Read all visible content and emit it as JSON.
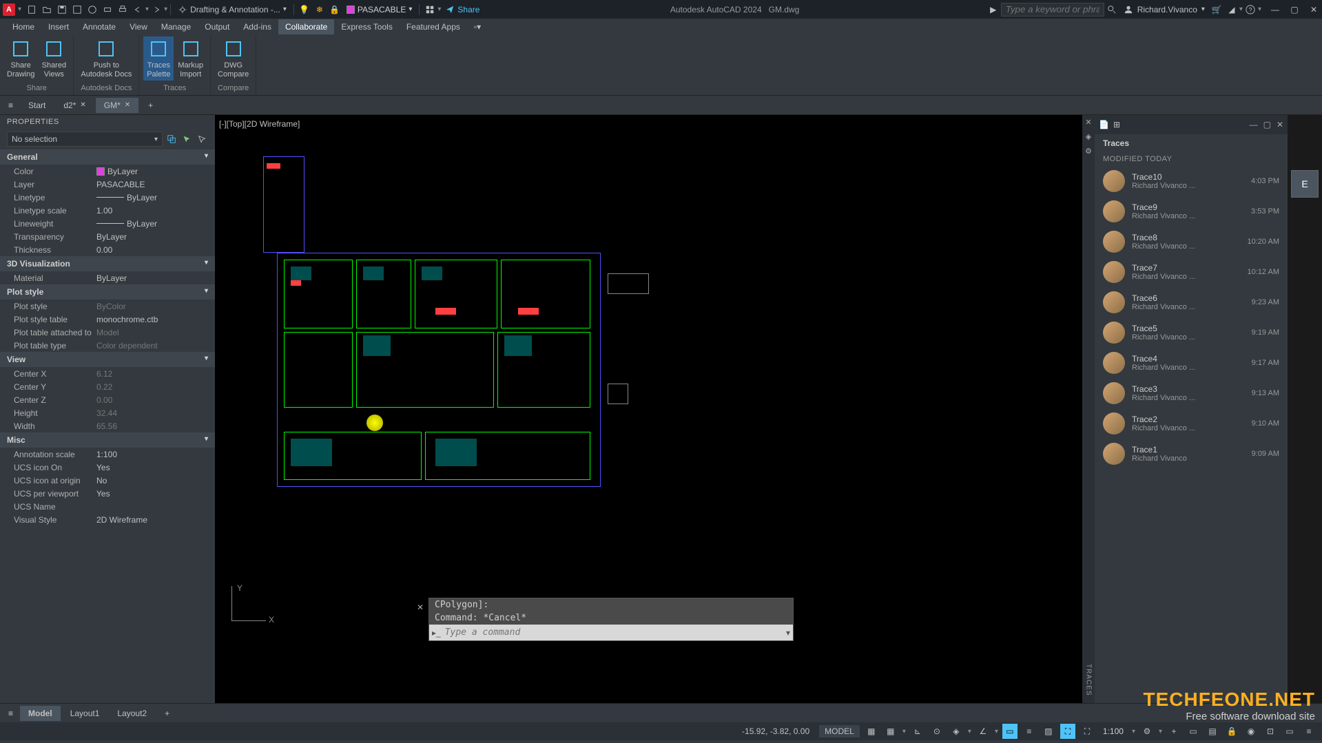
{
  "titlebar": {
    "logo": "A",
    "workspace": "Drafting & Annotation -...",
    "layer": "PASACABLE",
    "share": "Share",
    "app_name": "Autodesk AutoCAD 2024",
    "doc_name": "GM.dwg",
    "search_placeholder": "Type a keyword or phrase",
    "user": "Richard.Vivanco"
  },
  "menu": {
    "tabs": [
      "Home",
      "Insert",
      "Annotate",
      "View",
      "Manage",
      "Output",
      "Add-ins",
      "Collaborate",
      "Express Tools",
      "Featured Apps"
    ],
    "active": "Collaborate"
  },
  "ribbon": {
    "groups": [
      {
        "label": "Share",
        "buttons": [
          {
            "label1": "Share",
            "label2": "Drawing"
          },
          {
            "label1": "Shared",
            "label2": "Views"
          }
        ]
      },
      {
        "label": "Autodesk Docs",
        "buttons": [
          {
            "label1": "Push to",
            "label2": "Autodesk Docs"
          }
        ]
      },
      {
        "label": "Traces",
        "buttons": [
          {
            "label1": "Traces",
            "label2": "Palette",
            "active": true
          },
          {
            "label1": "Markup",
            "label2": "Import"
          }
        ]
      },
      {
        "label": "Compare",
        "buttons": [
          {
            "label1": "DWG",
            "label2": "Compare"
          }
        ]
      }
    ]
  },
  "filetabs": {
    "tabs": [
      {
        "label": "Start",
        "close": false
      },
      {
        "label": "d2*",
        "close": true
      },
      {
        "label": "GM*",
        "close": true,
        "active": true
      }
    ]
  },
  "properties": {
    "header": "PROPERTIES",
    "selection": "No selection",
    "sections": [
      {
        "title": "General",
        "rows": [
          {
            "label": "Color",
            "value": "ByLayer",
            "swatch": true
          },
          {
            "label": "Layer",
            "value": "PASACABLE"
          },
          {
            "label": "Linetype",
            "value": "ByLayer",
            "line": true
          },
          {
            "label": "Linetype scale",
            "value": "1.00"
          },
          {
            "label": "Lineweight",
            "value": "ByLayer",
            "line": true
          },
          {
            "label": "Transparency",
            "value": "ByLayer"
          },
          {
            "label": "Thickness",
            "value": "0.00"
          }
        ]
      },
      {
        "title": "3D Visualization",
        "rows": [
          {
            "label": "Material",
            "value": "ByLayer"
          }
        ]
      },
      {
        "title": "Plot style",
        "rows": [
          {
            "label": "Plot style",
            "value": "ByColor",
            "readonly": true
          },
          {
            "label": "Plot style table",
            "value": "monochrome.ctb"
          },
          {
            "label": "Plot table attached to",
            "value": "Model",
            "readonly": true
          },
          {
            "label": "Plot table type",
            "value": "Color dependent",
            "readonly": true
          }
        ]
      },
      {
        "title": "View",
        "rows": [
          {
            "label": "Center X",
            "value": "6.12",
            "readonly": true
          },
          {
            "label": "Center Y",
            "value": "0.22",
            "readonly": true
          },
          {
            "label": "Center Z",
            "value": "0.00",
            "readonly": true
          },
          {
            "label": "Height",
            "value": "32.44",
            "readonly": true
          },
          {
            "label": "Width",
            "value": "65.56",
            "readonly": true
          }
        ]
      },
      {
        "title": "Misc",
        "rows": [
          {
            "label": "Annotation scale",
            "value": "1:100"
          },
          {
            "label": "UCS icon On",
            "value": "Yes"
          },
          {
            "label": "UCS icon at origin",
            "value": "No"
          },
          {
            "label": "UCS per viewport",
            "value": "Yes"
          },
          {
            "label": "UCS Name",
            "value": ""
          },
          {
            "label": "Visual Style",
            "value": "2D Wireframe"
          }
        ]
      }
    ]
  },
  "viewport": {
    "label": "[-][Top][2D Wireframe]",
    "ucs_y": "Y",
    "ucs_x": "X"
  },
  "cmdline": {
    "history1": "CPolygon]:",
    "history2": "Command: *Cancel*",
    "placeholder": "Type a command"
  },
  "traces": {
    "title": "Traces",
    "subheader": "MODIFIED TODAY",
    "vlabel": "TRACES",
    "items": [
      {
        "name": "Trace10",
        "author": "Richard Vivanco ...",
        "time": "4:03 PM"
      },
      {
        "name": "Trace9",
        "author": "Richard Vivanco ...",
        "time": "3:53 PM"
      },
      {
        "name": "Trace8",
        "author": "Richard Vivanco ...",
        "time": "10:20 AM"
      },
      {
        "name": "Trace7",
        "author": "Richard Vivanco ...",
        "time": "10:12 AM"
      },
      {
        "name": "Trace6",
        "author": "Richard Vivanco ...",
        "time": "9:23 AM"
      },
      {
        "name": "Trace5",
        "author": "Richard Vivanco ...",
        "time": "9:19 AM"
      },
      {
        "name": "Trace4",
        "author": "Richard Vivanco ...",
        "time": "9:17 AM"
      },
      {
        "name": "Trace3",
        "author": "Richard Vivanco ...",
        "time": "9:13 AM"
      },
      {
        "name": "Trace2",
        "author": "Richard Vivanco ...",
        "time": "9:10 AM"
      },
      {
        "name": "Trace1",
        "author": "Richard Vivanco",
        "time": "9:09 AM"
      }
    ]
  },
  "viewcube": {
    "face": "E"
  },
  "layout_tabs": {
    "tabs": [
      {
        "label": "Model",
        "active": true
      },
      {
        "label": "Layout1"
      },
      {
        "label": "Layout2"
      }
    ]
  },
  "statusbar": {
    "coords": "-15.92, -3.82, 0.00",
    "model": "MODEL",
    "scale": "1:100"
  },
  "watermark": {
    "title": "TECHFEONE.NET",
    "sub": "Free software download site"
  }
}
